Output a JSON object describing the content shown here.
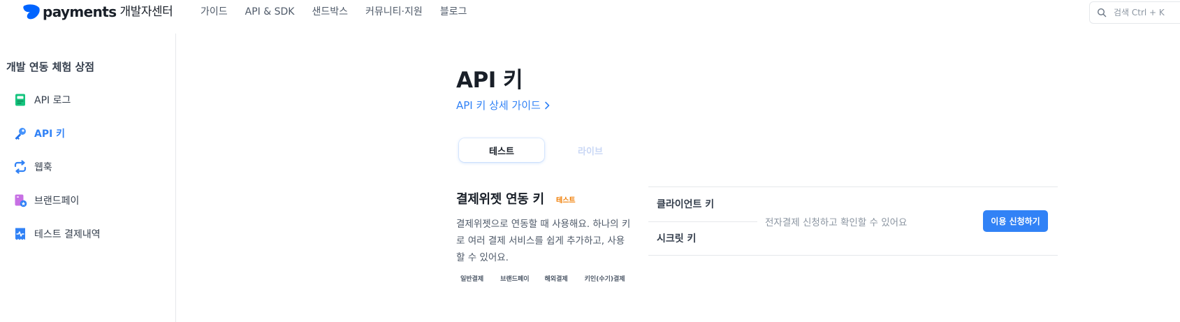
{
  "header": {
    "logo_word": "payments",
    "logo_sub": "개발자센터",
    "nav": [
      "가이드",
      "API & SDK",
      "샌드박스",
      "커뮤니티·지원",
      "블로그"
    ],
    "search_placeholder": "검색 Ctrl + K"
  },
  "sidebar": {
    "title": "개발 연동 체험 상점",
    "items": [
      {
        "label": "API 로그",
        "icon": "api-log-icon",
        "active": false
      },
      {
        "label": "API 키",
        "icon": "key-icon",
        "active": true
      },
      {
        "label": "웹훅",
        "icon": "webhook-icon",
        "active": false
      },
      {
        "label": "브랜드페이",
        "icon": "brandpay-icon",
        "active": false
      },
      {
        "label": "테스트 결제내역",
        "icon": "receipt-icon",
        "active": false
      }
    ]
  },
  "main": {
    "title": "API 키",
    "guide_link": "API 키 상세 가이드",
    "tabs": [
      {
        "label": "테스트",
        "active": true
      },
      {
        "label": "라이브",
        "active": false
      }
    ],
    "section": {
      "title": "결제위젯 연동 키",
      "env_badge": "테스트",
      "description": "결제위젯으로 연동할 때 사용해요. 하나의 키로 여러 결제 서비스를 쉽게 추가하고, 사용할 수 있어요.",
      "tags": [
        "일반결제",
        "브랜드페이",
        "해외결제",
        "키인(수기)결제"
      ]
    },
    "keys": {
      "client_key_label": "클라이언트 키",
      "secret_key_label": "시크릿 키",
      "notice": "전자결제 신청하고 확인할 수 있어요",
      "apply_button": "이용 신청하기"
    }
  },
  "colors": {
    "accent": "#3182f6",
    "badge": "#f07c00",
    "text_primary": "#191f28",
    "text_secondary": "#4e5968",
    "border": "#e5e8eb"
  }
}
